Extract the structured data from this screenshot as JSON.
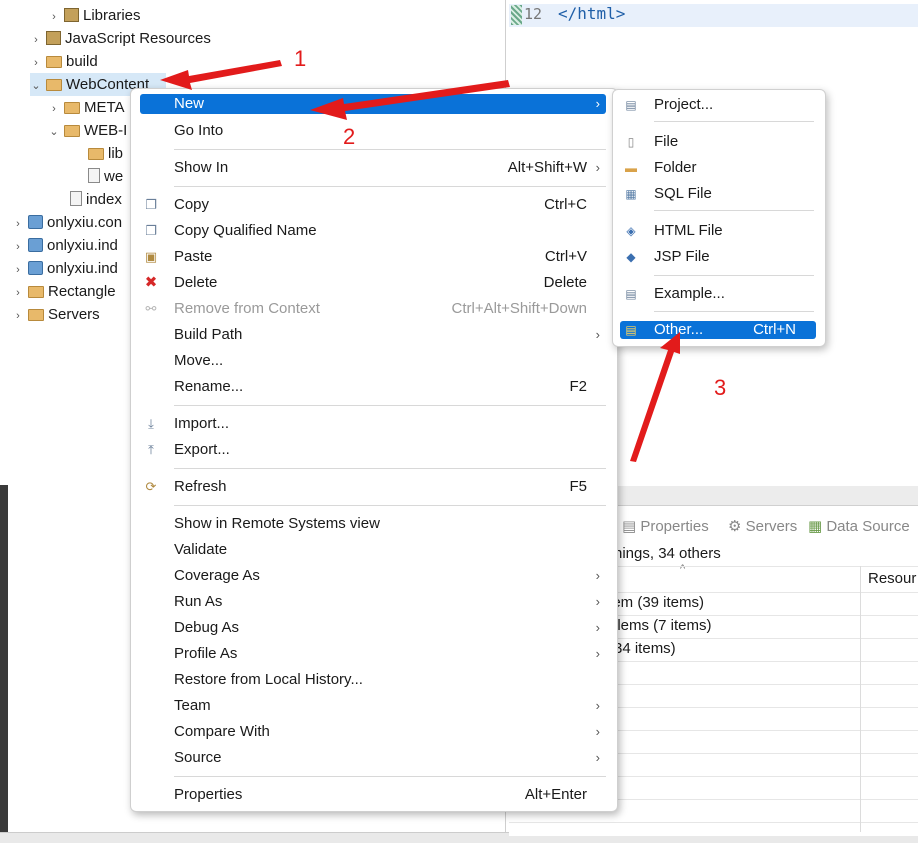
{
  "explorer": {
    "items": [
      {
        "label": "Libraries"
      },
      {
        "label": "JavaScript Resources"
      },
      {
        "label": "build"
      },
      {
        "label": "WebContent"
      },
      {
        "label": "META"
      },
      {
        "label": "WEB-I"
      },
      {
        "label": "lib"
      },
      {
        "label": "we"
      },
      {
        "label": "index"
      },
      {
        "label": "onlyxiu.con"
      },
      {
        "label": "onlyxiu.ind"
      },
      {
        "label": "onlyxiu.ind"
      },
      {
        "label": "Rectangle"
      },
      {
        "label": "Servers"
      }
    ]
  },
  "editor": {
    "line_number": "12",
    "code": "</html>"
  },
  "bottom_panel": {
    "tabs": [
      {
        "label": "Properties"
      },
      {
        "label": "Servers"
      },
      {
        "label": "Data Source"
      }
    ],
    "summary": "rnings, 34 others",
    "column_header": "Resour",
    "rows": [
      {
        "label": "lem (39 items)"
      },
      {
        "label": "blems (7 items)"
      },
      {
        "label": "(34 items)"
      }
    ]
  },
  "context_menu": {
    "items": [
      {
        "label": "New",
        "shortcut": ""
      },
      {
        "label": "Go Into",
        "shortcut": ""
      },
      {
        "label": "Show In",
        "shortcut": "Alt+Shift+W"
      },
      {
        "label": "Copy",
        "shortcut": "Ctrl+C"
      },
      {
        "label": "Copy Qualified Name",
        "shortcut": ""
      },
      {
        "label": "Paste",
        "shortcut": "Ctrl+V"
      },
      {
        "label": "Delete",
        "shortcut": "Delete"
      },
      {
        "label": "Remove from Context",
        "shortcut": "Ctrl+Alt+Shift+Down"
      },
      {
        "label": "Build Path",
        "shortcut": ""
      },
      {
        "label": "Move...",
        "shortcut": ""
      },
      {
        "label": "Rename...",
        "shortcut": "F2"
      },
      {
        "label": "Import...",
        "shortcut": ""
      },
      {
        "label": "Export...",
        "shortcut": ""
      },
      {
        "label": "Refresh",
        "shortcut": "F5"
      },
      {
        "label": "Show in Remote Systems view",
        "shortcut": ""
      },
      {
        "label": "Validate",
        "shortcut": ""
      },
      {
        "label": "Coverage As",
        "shortcut": ""
      },
      {
        "label": "Run As",
        "shortcut": ""
      },
      {
        "label": "Debug As",
        "shortcut": ""
      },
      {
        "label": "Profile As",
        "shortcut": ""
      },
      {
        "label": "Restore from Local History...",
        "shortcut": ""
      },
      {
        "label": "Team",
        "shortcut": ""
      },
      {
        "label": "Compare With",
        "shortcut": ""
      },
      {
        "label": "Source",
        "shortcut": ""
      },
      {
        "label": "Properties",
        "shortcut": "Alt+Enter"
      }
    ]
  },
  "submenu": {
    "items": [
      {
        "label": "Project...",
        "shortcut": ""
      },
      {
        "label": "File",
        "shortcut": ""
      },
      {
        "label": "Folder",
        "shortcut": ""
      },
      {
        "label": "SQL File",
        "shortcut": ""
      },
      {
        "label": "HTML File",
        "shortcut": ""
      },
      {
        "label": "JSP File",
        "shortcut": ""
      },
      {
        "label": "Example...",
        "shortcut": ""
      },
      {
        "label": "Other...",
        "shortcut": "Ctrl+N"
      }
    ]
  },
  "annotations": {
    "step1": "1",
    "step2": "2",
    "step3": "3"
  },
  "colors": {
    "highlight": "#0a72d8",
    "annotation": "#e21b1b",
    "selection": "#d6e8f7"
  }
}
